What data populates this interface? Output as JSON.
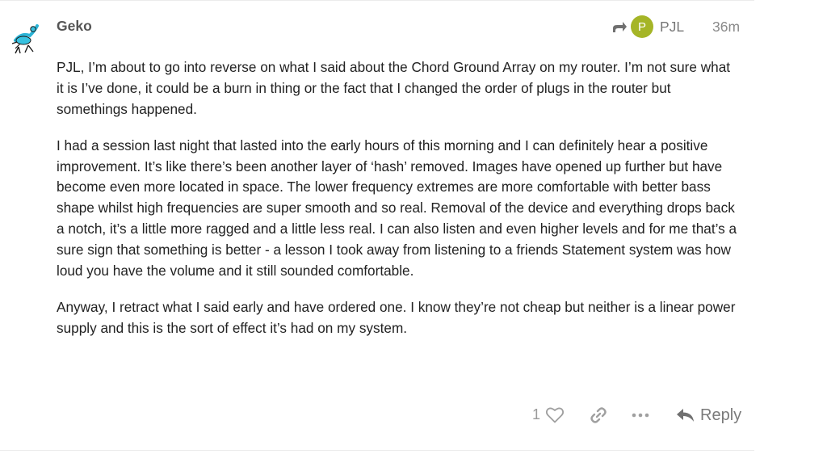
{
  "post": {
    "username": "Geko",
    "reply_to": {
      "avatar_letter": "P",
      "name": "PJL",
      "avatar_color": "#a5b527"
    },
    "timestamp": "36m",
    "paragraphs": [
      "PJL, I’m about to go into reverse on what I said about the Chord Ground Array on my router. I’m not sure what it is I’ve done, it could be a burn in thing or the fact that I changed the order of plugs in the router but somethings happened.",
      "I had a session last night that lasted into the early hours of this morning and I can definitely hear a positive improvement. It’s like there’s been another layer of ‘hash’ removed. Images have opened up further but have become even more located in space. The lower frequency extremes are more comfortable with better bass shape whilst high frequencies are super smooth and so real. Removal of the device and everything drops back a notch, it’s a little more ragged and a little less real. I can also listen and even higher levels and for me that’s a sure sign that something is better - a lesson I took away from listening to a friends Statement system was how loud you have the volume and it still sounded comfortable.",
      "Anyway, I retract what I said early and have ordered one. I know they’re not cheap but neither is a linear power supply and this is the sort of effect it’s had on my system."
    ],
    "actions": {
      "like_count": "1",
      "reply_label": "Reply"
    }
  },
  "icons": {
    "avatar": "frog-avatar-icon",
    "reply_to": "share-arrow-icon",
    "like": "heart-icon",
    "link": "link-icon",
    "more": "ellipsis-icon",
    "reply": "reply-arrow-icon"
  }
}
